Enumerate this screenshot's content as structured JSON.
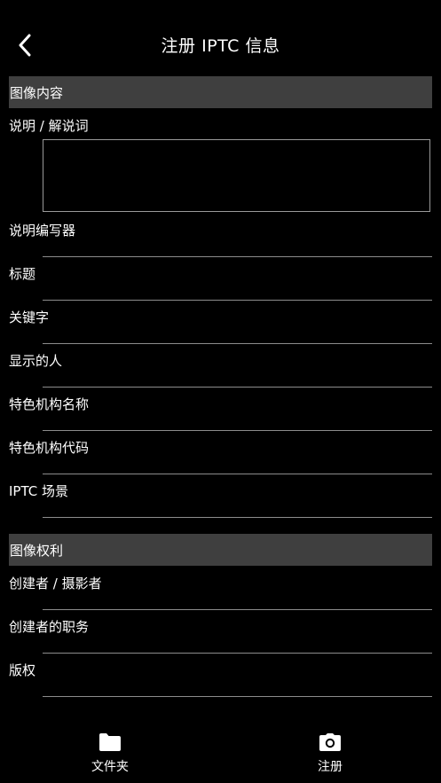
{
  "header": {
    "title": "注册 IPTC 信息",
    "back_icon": "chevron-left-icon"
  },
  "sections": [
    {
      "title": "图像内容",
      "fields": [
        {
          "label": "说明 / 解说词",
          "type": "textarea",
          "value": ""
        },
        {
          "label": "说明编写器",
          "type": "text",
          "value": ""
        },
        {
          "label": "标题",
          "type": "text",
          "value": ""
        },
        {
          "label": "关键字",
          "type": "text",
          "value": ""
        },
        {
          "label": "显示的人",
          "type": "text",
          "value": ""
        },
        {
          "label": "特色机构名称",
          "type": "text",
          "value": ""
        },
        {
          "label": "特色机构代码",
          "type": "text",
          "value": ""
        },
        {
          "label": "IPTC 场景",
          "type": "text",
          "value": ""
        }
      ]
    },
    {
      "title": "图像权利",
      "fields": [
        {
          "label": "创建者 / 摄影者",
          "type": "text",
          "value": ""
        },
        {
          "label": "创建者的职务",
          "type": "text",
          "value": ""
        },
        {
          "label": "版权",
          "type": "text",
          "value": ""
        }
      ]
    }
  ],
  "bottom_nav": {
    "items": [
      {
        "label": "文件夹",
        "icon": "folder-icon"
      },
      {
        "label": "注册",
        "icon": "camera-icon"
      }
    ]
  },
  "colors": {
    "background": "#000000",
    "section_header": "#3f3f3f",
    "text": "#ffffff",
    "line": "#8c8c8c"
  }
}
